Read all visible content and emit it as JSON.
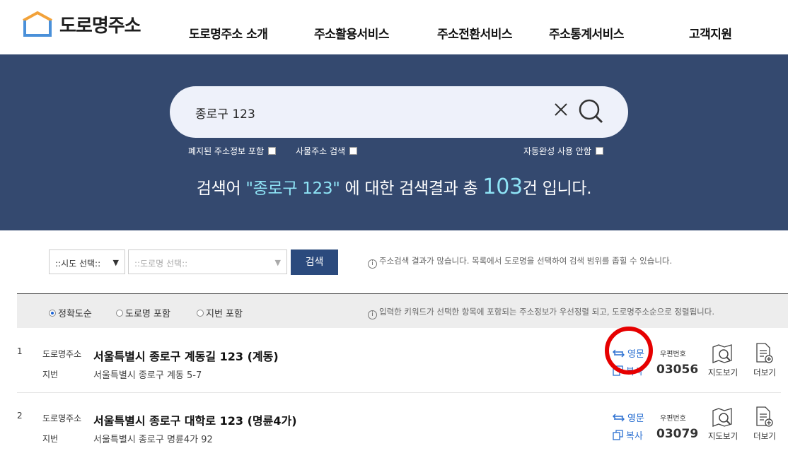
{
  "header": {
    "logo_text": "도로명주소",
    "nav": [
      "도로명주소 소개",
      "주소활용서비스",
      "주소전환서비스",
      "주소통계서비스",
      "고객지원"
    ]
  },
  "search": {
    "value": "종로구 123",
    "opt_abolished": "폐지된 주소정보 포함",
    "opt_building": "사물주소 검색",
    "opt_autocomplete": "자동완성 사용 안함"
  },
  "summary": {
    "prefix": "검색어 ",
    "query_quoted": "\"종로구 123\"",
    "middle": " 에 대한 검색결과 총 ",
    "count": "103",
    "suffix": "건 입니다."
  },
  "filter": {
    "sido_select": "::시도 선택::",
    "road_select": "::도로명 선택::",
    "search_button": "검색",
    "info": "주소검색 결과가 많습니다. 목록에서 도로명을 선택하여 검색 범위를 좁힐 수 있습니다."
  },
  "sort": {
    "options": [
      "정확도순",
      "도로명 포함",
      "지번 포함"
    ],
    "selected": "정확도순",
    "info": "입력한 키워드가 선택한 항목에 포함되는 주소정보가 우선정렬 되고, 도로명주소순으로 정렬됩니다."
  },
  "results": [
    {
      "num": "1",
      "road_label": "도로명주소",
      "road_addr": "서울특별시 종로구 계동길 123 (계동)",
      "jibun_label": "지번",
      "jibun_addr": "서울특별시 종로구 계동 5-7",
      "eng": "영문",
      "copy": "복사",
      "post_label": "우편번호",
      "postcode": "03056",
      "map": "지도보기",
      "more": "더보기"
    },
    {
      "num": "2",
      "road_label": "도로명주소",
      "road_addr": "서울특별시 종로구 대학로 123 (명륜4가)",
      "jibun_label": "지번",
      "jibun_addr": "서울특별시 종로구 명륜4가 92",
      "eng": "영문",
      "copy": "복사",
      "post_label": "우편번호",
      "postcode": "03079",
      "map": "지도보기",
      "more": "더보기"
    }
  ],
  "colors": {
    "banner": "#34496f",
    "accent": "#2b4a7d",
    "link": "#2a6fd1",
    "highlight": "#8ee3f5",
    "annotation": "#e60000"
  }
}
